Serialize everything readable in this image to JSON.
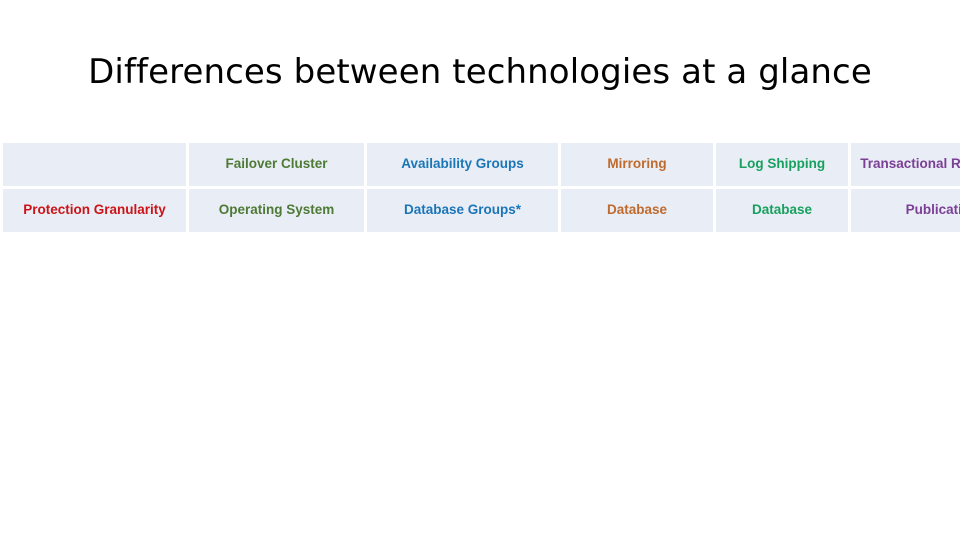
{
  "slide": {
    "title": "Differences between technologies at a glance"
  },
  "table": {
    "columns": [
      {
        "key": "corner",
        "label": ""
      },
      {
        "key": "failover",
        "label": "Failover Cluster",
        "color": "#4e7a36"
      },
      {
        "key": "ag",
        "label": "Availability Groups",
        "color": "#1b76b8"
      },
      {
        "key": "mirroring",
        "label": "Mirroring",
        "color": "#bf6a2e"
      },
      {
        "key": "logshipping",
        "label": "Log Shipping",
        "color": "#17a05e"
      },
      {
        "key": "replication",
        "label": "Transactional Replication",
        "color": "#7b3f96"
      }
    ],
    "rows": [
      {
        "label": "Protection Granularity",
        "label_color": "#cc1418",
        "cells": [
          {
            "text": "Operating System",
            "color": "#4e7a36"
          },
          {
            "text": "Database Groups*",
            "color": "#1b76b8"
          },
          {
            "text": "Database",
            "color": "#bf6a2e"
          },
          {
            "text": "Database",
            "color": "#17a05e"
          },
          {
            "text": "Publication",
            "color": "#7b3f96"
          }
        ]
      }
    ]
  }
}
